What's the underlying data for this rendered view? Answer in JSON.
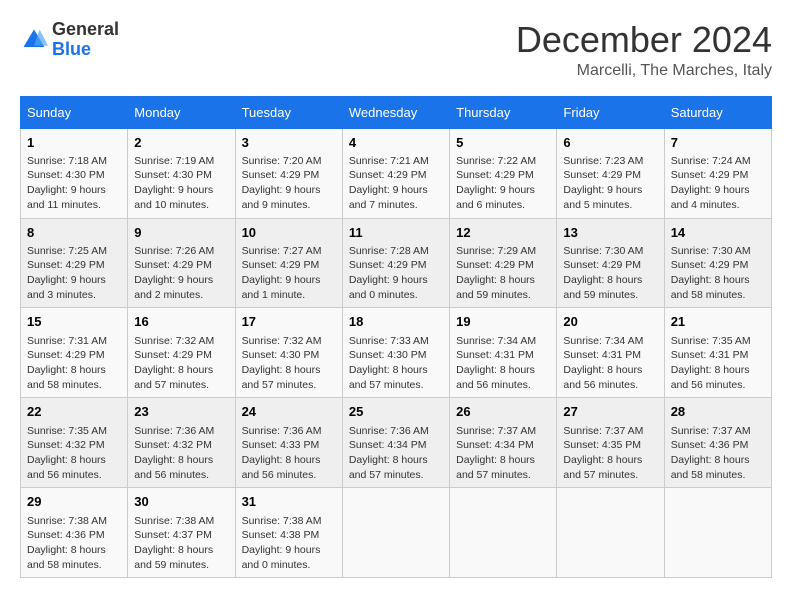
{
  "header": {
    "logo_line1": "General",
    "logo_line2": "Blue",
    "month": "December 2024",
    "location": "Marcelli, The Marches, Italy"
  },
  "weekdays": [
    "Sunday",
    "Monday",
    "Tuesday",
    "Wednesday",
    "Thursday",
    "Friday",
    "Saturday"
  ],
  "weeks": [
    [
      {
        "day": "1",
        "sunrise": "Sunrise: 7:18 AM",
        "sunset": "Sunset: 4:30 PM",
        "daylight": "Daylight: 9 hours and 11 minutes."
      },
      {
        "day": "2",
        "sunrise": "Sunrise: 7:19 AM",
        "sunset": "Sunset: 4:30 PM",
        "daylight": "Daylight: 9 hours and 10 minutes."
      },
      {
        "day": "3",
        "sunrise": "Sunrise: 7:20 AM",
        "sunset": "Sunset: 4:29 PM",
        "daylight": "Daylight: 9 hours and 9 minutes."
      },
      {
        "day": "4",
        "sunrise": "Sunrise: 7:21 AM",
        "sunset": "Sunset: 4:29 PM",
        "daylight": "Daylight: 9 hours and 7 minutes."
      },
      {
        "day": "5",
        "sunrise": "Sunrise: 7:22 AM",
        "sunset": "Sunset: 4:29 PM",
        "daylight": "Daylight: 9 hours and 6 minutes."
      },
      {
        "day": "6",
        "sunrise": "Sunrise: 7:23 AM",
        "sunset": "Sunset: 4:29 PM",
        "daylight": "Daylight: 9 hours and 5 minutes."
      },
      {
        "day": "7",
        "sunrise": "Sunrise: 7:24 AM",
        "sunset": "Sunset: 4:29 PM",
        "daylight": "Daylight: 9 hours and 4 minutes."
      }
    ],
    [
      {
        "day": "8",
        "sunrise": "Sunrise: 7:25 AM",
        "sunset": "Sunset: 4:29 PM",
        "daylight": "Daylight: 9 hours and 3 minutes."
      },
      {
        "day": "9",
        "sunrise": "Sunrise: 7:26 AM",
        "sunset": "Sunset: 4:29 PM",
        "daylight": "Daylight: 9 hours and 2 minutes."
      },
      {
        "day": "10",
        "sunrise": "Sunrise: 7:27 AM",
        "sunset": "Sunset: 4:29 PM",
        "daylight": "Daylight: 9 hours and 1 minute."
      },
      {
        "day": "11",
        "sunrise": "Sunrise: 7:28 AM",
        "sunset": "Sunset: 4:29 PM",
        "daylight": "Daylight: 9 hours and 0 minutes."
      },
      {
        "day": "12",
        "sunrise": "Sunrise: 7:29 AM",
        "sunset": "Sunset: 4:29 PM",
        "daylight": "Daylight: 8 hours and 59 minutes."
      },
      {
        "day": "13",
        "sunrise": "Sunrise: 7:30 AM",
        "sunset": "Sunset: 4:29 PM",
        "daylight": "Daylight: 8 hours and 59 minutes."
      },
      {
        "day": "14",
        "sunrise": "Sunrise: 7:30 AM",
        "sunset": "Sunset: 4:29 PM",
        "daylight": "Daylight: 8 hours and 58 minutes."
      }
    ],
    [
      {
        "day": "15",
        "sunrise": "Sunrise: 7:31 AM",
        "sunset": "Sunset: 4:29 PM",
        "daylight": "Daylight: 8 hours and 58 minutes."
      },
      {
        "day": "16",
        "sunrise": "Sunrise: 7:32 AM",
        "sunset": "Sunset: 4:29 PM",
        "daylight": "Daylight: 8 hours and 57 minutes."
      },
      {
        "day": "17",
        "sunrise": "Sunrise: 7:32 AM",
        "sunset": "Sunset: 4:30 PM",
        "daylight": "Daylight: 8 hours and 57 minutes."
      },
      {
        "day": "18",
        "sunrise": "Sunrise: 7:33 AM",
        "sunset": "Sunset: 4:30 PM",
        "daylight": "Daylight: 8 hours and 57 minutes."
      },
      {
        "day": "19",
        "sunrise": "Sunrise: 7:34 AM",
        "sunset": "Sunset: 4:31 PM",
        "daylight": "Daylight: 8 hours and 56 minutes."
      },
      {
        "day": "20",
        "sunrise": "Sunrise: 7:34 AM",
        "sunset": "Sunset: 4:31 PM",
        "daylight": "Daylight: 8 hours and 56 minutes."
      },
      {
        "day": "21",
        "sunrise": "Sunrise: 7:35 AM",
        "sunset": "Sunset: 4:31 PM",
        "daylight": "Daylight: 8 hours and 56 minutes."
      }
    ],
    [
      {
        "day": "22",
        "sunrise": "Sunrise: 7:35 AM",
        "sunset": "Sunset: 4:32 PM",
        "daylight": "Daylight: 8 hours and 56 minutes."
      },
      {
        "day": "23",
        "sunrise": "Sunrise: 7:36 AM",
        "sunset": "Sunset: 4:32 PM",
        "daylight": "Daylight: 8 hours and 56 minutes."
      },
      {
        "day": "24",
        "sunrise": "Sunrise: 7:36 AM",
        "sunset": "Sunset: 4:33 PM",
        "daylight": "Daylight: 8 hours and 56 minutes."
      },
      {
        "day": "25",
        "sunrise": "Sunrise: 7:36 AM",
        "sunset": "Sunset: 4:34 PM",
        "daylight": "Daylight: 8 hours and 57 minutes."
      },
      {
        "day": "26",
        "sunrise": "Sunrise: 7:37 AM",
        "sunset": "Sunset: 4:34 PM",
        "daylight": "Daylight: 8 hours and 57 minutes."
      },
      {
        "day": "27",
        "sunrise": "Sunrise: 7:37 AM",
        "sunset": "Sunset: 4:35 PM",
        "daylight": "Daylight: 8 hours and 57 minutes."
      },
      {
        "day": "28",
        "sunrise": "Sunrise: 7:37 AM",
        "sunset": "Sunset: 4:36 PM",
        "daylight": "Daylight: 8 hours and 58 minutes."
      }
    ],
    [
      {
        "day": "29",
        "sunrise": "Sunrise: 7:38 AM",
        "sunset": "Sunset: 4:36 PM",
        "daylight": "Daylight: 8 hours and 58 minutes."
      },
      {
        "day": "30",
        "sunrise": "Sunrise: 7:38 AM",
        "sunset": "Sunset: 4:37 PM",
        "daylight": "Daylight: 8 hours and 59 minutes."
      },
      {
        "day": "31",
        "sunrise": "Sunrise: 7:38 AM",
        "sunset": "Sunset: 4:38 PM",
        "daylight": "Daylight: 9 hours and 0 minutes."
      },
      null,
      null,
      null,
      null
    ]
  ]
}
